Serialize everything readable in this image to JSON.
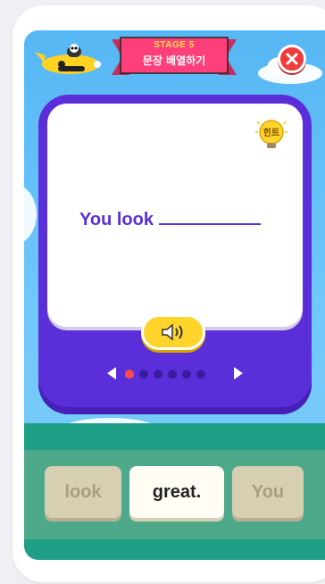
{
  "header": {
    "stage_label": "STAGE 5",
    "subtitle": "문장 배열하기"
  },
  "card": {
    "hint_label": "힌트",
    "sentence_prefix": "You look"
  },
  "pager": {
    "total_dots": 6,
    "active_index": 0
  },
  "word_tiles": [
    {
      "text": "look",
      "state": "used"
    },
    {
      "text": "great.",
      "state": "current"
    },
    {
      "text": "You",
      "state": "used"
    }
  ],
  "colors": {
    "card_frame": "#5a2fd9",
    "close_button": "#ef3b3b",
    "speaker_button": "#ffd42a",
    "tray": "#1e9f85",
    "banner": "#ff3f7a"
  }
}
